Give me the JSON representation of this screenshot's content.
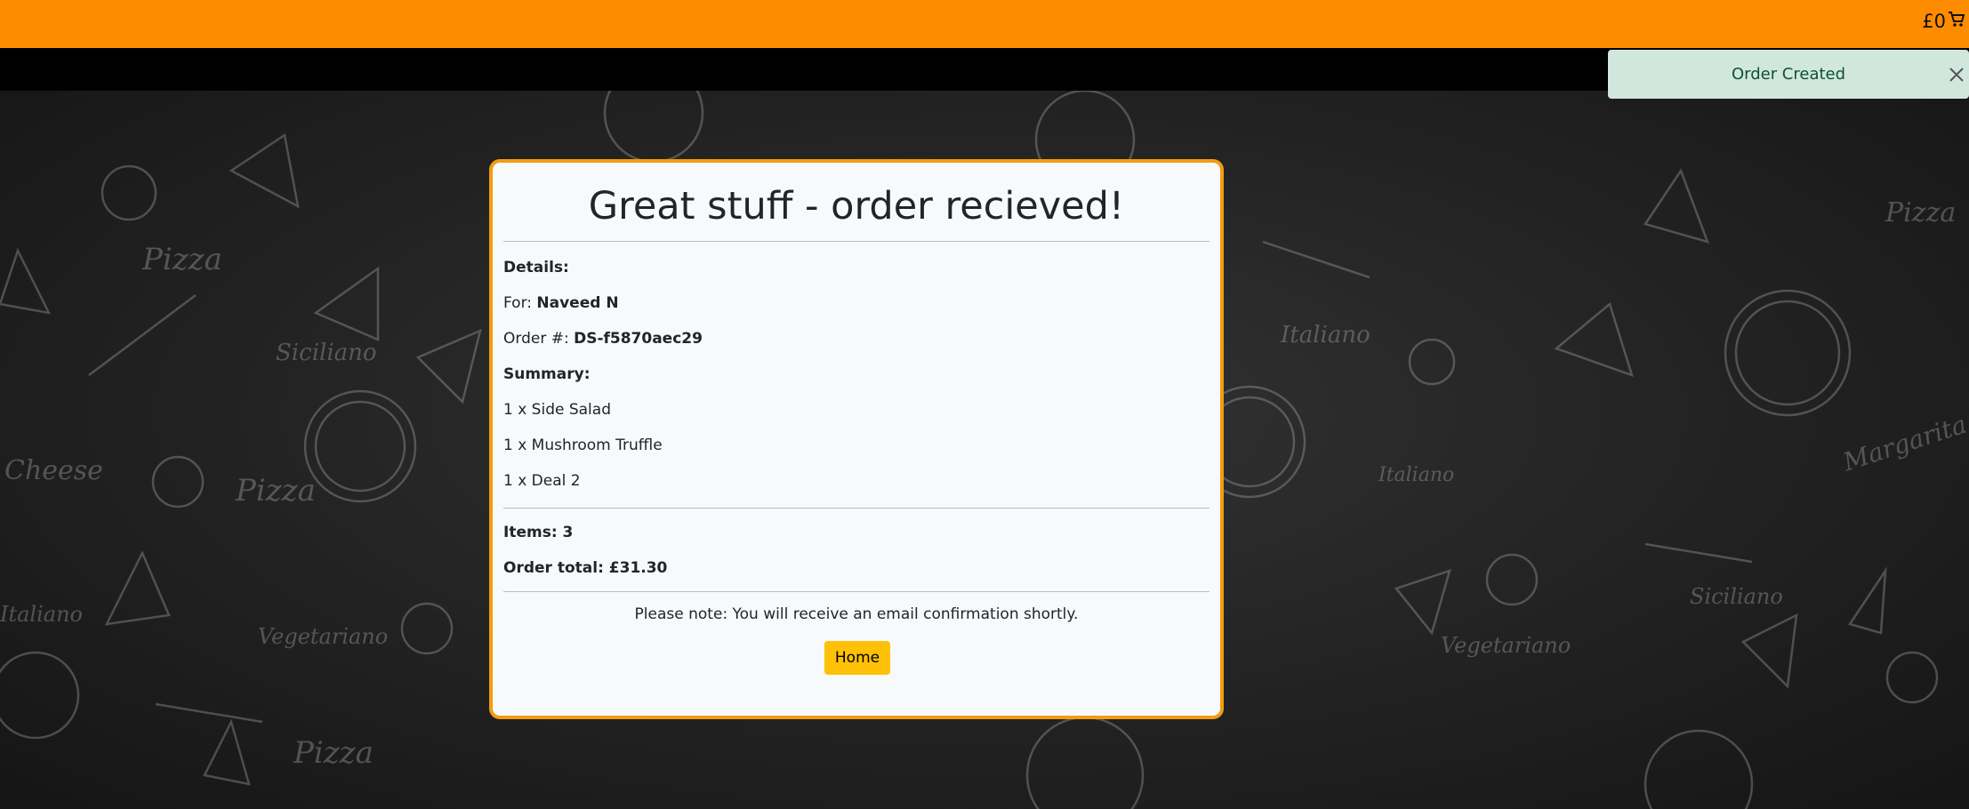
{
  "header": {
    "cart_total": "£0"
  },
  "toast": {
    "message": "Order Created"
  },
  "background": {
    "words": [
      "Pizza",
      "Siciliano",
      "Cheese",
      "Pizza",
      "Vegetariano",
      "Pizza",
      "Italiano",
      "Italiano",
      "Margarita",
      "Vegetariano",
      "Siciliano",
      "Pizza",
      "Italiano"
    ]
  },
  "order": {
    "title": "Great stuff - order recieved!",
    "details_label": "Details:",
    "for_label": "For:",
    "customer_name": "Naveed N",
    "order_number_label": "Order #:",
    "order_number": "DS-f5870aec29",
    "summary_label": "Summary:",
    "items": [
      "1 x Side Salad",
      "1 x Mushroom Truffle",
      "1 x Deal 2"
    ],
    "items_count_text": "Items: 3",
    "order_total_text": "Order total: £31.30",
    "note": "Please note: You will receive an email confirmation shortly.",
    "home_button": "Home"
  },
  "colors": {
    "topbar": "#ff8c00",
    "card_border": "#f39c12",
    "button": "#ffc107",
    "toast_bg": "#d1e7dd"
  }
}
